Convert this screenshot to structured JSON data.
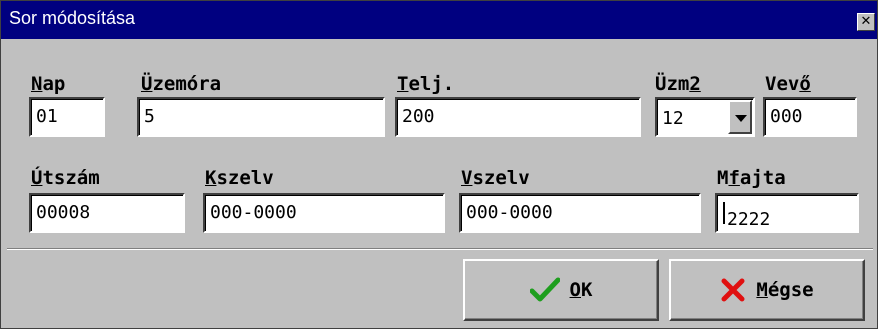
{
  "window": {
    "title": "Sor módosítása",
    "close_glyph": "✕"
  },
  "fields": {
    "nap": {
      "label_hot": "N",
      "label_rest": "ap",
      "value": "01"
    },
    "uzemora": {
      "label_hot": "Ü",
      "label_rest": "zemóra",
      "value": "5"
    },
    "telj": {
      "label_hot": "T",
      "label_rest": "elj.",
      "value": "200"
    },
    "uzm2": {
      "label_pre": "Üzm",
      "label_hot": "2",
      "value": "12"
    },
    "vevo": {
      "label_pre": "Vev",
      "label_hot": "ő",
      "value": "000"
    },
    "utszam": {
      "label_hot": "Ú",
      "label_rest": "tszám",
      "value": "00008"
    },
    "kszelv": {
      "label_hot": "K",
      "label_rest": "szelv",
      "value": "000-0000"
    },
    "vszelv": {
      "label_hot": "V",
      "label_rest": "szelv",
      "value": "000-0000"
    },
    "mfajta": {
      "label_pre": "M",
      "label_hot": "f",
      "label_rest": "ajta",
      "value": "2222"
    }
  },
  "buttons": {
    "ok": {
      "hot": "O",
      "rest": "K",
      "icon": "checkmark-icon",
      "icon_color": "#1e9e1e"
    },
    "cancel": {
      "hot": "M",
      "rest": "égse",
      "icon": "x-mark-icon",
      "icon_color": "#e01010"
    }
  }
}
